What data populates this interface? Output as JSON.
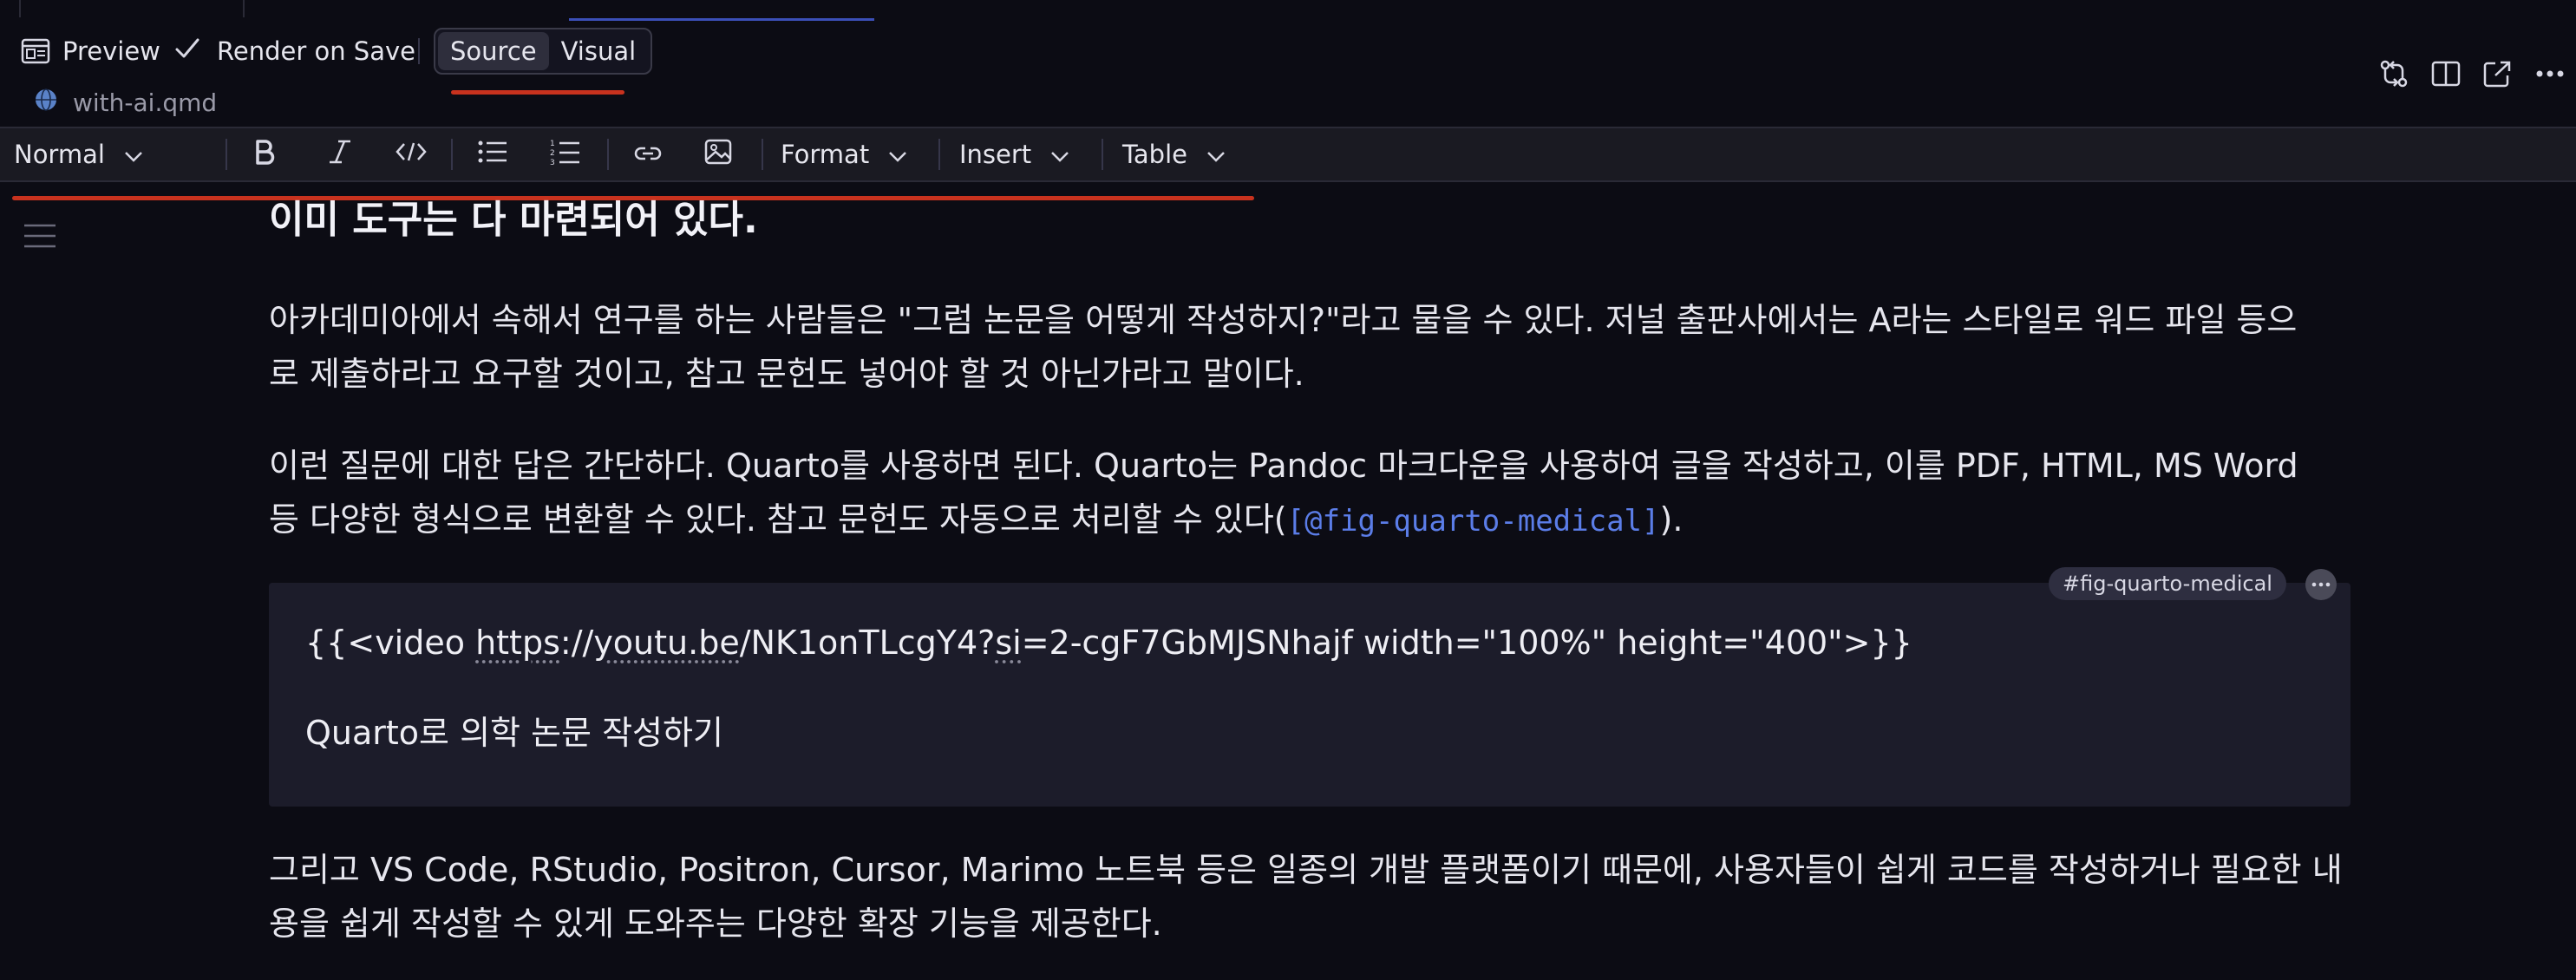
{
  "preview_bar": {
    "preview_label": "Preview",
    "render_on_save_label": "Render on Save",
    "render_on_save_checked": true,
    "mode_tabs": [
      {
        "label": "Source",
        "active": true
      },
      {
        "label": "Visual",
        "active": false
      }
    ]
  },
  "file": {
    "name": "with-ai.qmd"
  },
  "toolbar": {
    "block_format": "Normal",
    "format_menu": "Format",
    "insert_menu": "Insert",
    "table_menu": "Table"
  },
  "document": {
    "heading": "이미 도구는 다 마련되어 있다.",
    "para1": {
      "line1": "아카데미아에서 속해서 연구를 하는 사람들은 \"그럼 논문을 어떻게 작성하지?\"라고 물을 수 있다. 저널 출판사에서는 A라는 스타일로 워드 파일 등으",
      "line2": "로 제출하라고 요구할 것이고, 참고 문헌도 넣어야 할 것 아닌가라고 말이다."
    },
    "para2": {
      "line1": "이런 질문에 대한 답은 간단하다. Quarto를 사용하면 된다. Quarto는 Pandoc 마크다운을 사용하여 글을 작성하고, 이를 PDF, HTML, MS Word",
      "line2_text": "등 다양한 형식으로 변환할 수 있다. 참고 문헌도 자동으로 처리할 수 있다(",
      "line2_ref": "[@fig-quarto-medical]",
      "line2_end": ")."
    },
    "figure": {
      "badge": "#fig-quarto-medical",
      "shortcode_start": "{{<video ",
      "shortcode_url_a": "https",
      "shortcode_url_b": "://",
      "shortcode_url_c": "youtu.be",
      "shortcode_url_d": "/NK1onTLcgY4?",
      "shortcode_url_e": "si",
      "shortcode_rest": "=2-cgF7GbMJSNhajf width=\"100%\" height=\"400\">}}",
      "caption": "Quarto로 의학 논문 작성하기"
    },
    "para3": {
      "line1": "그리고 VS Code, RStudio, Positron, Cursor, Marimo 노트북 등은 일종의 개발 플랫폼이기 때문에, 사용자들이 쉽게 코드를 작성하거나 필요한 내",
      "line2": "용을 쉽게 작성할 수 있게 도와주는 다양한 확장 기능을 제공한다."
    }
  },
  "colors": {
    "background": "#0c0c14",
    "toolbar": "#1a1a22",
    "figure_bg": "#1c1c2a",
    "xref": "#5b7de8",
    "annotation_red": "#c8321e"
  }
}
